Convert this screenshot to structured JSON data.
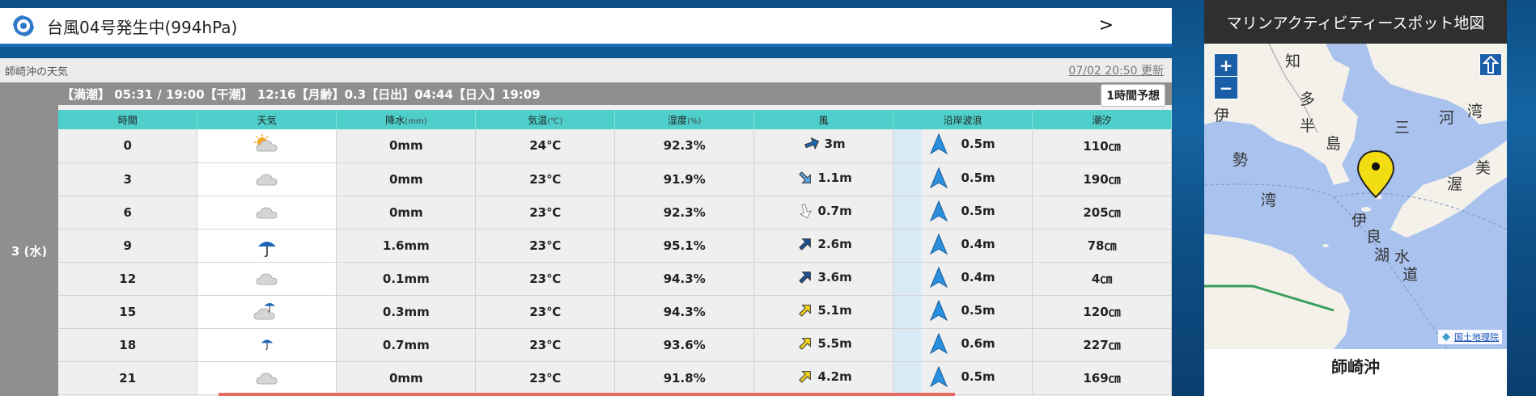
{
  "banner": {
    "text": "台風04号発生中(994hPa)",
    "arrow": ">"
  },
  "panel": {
    "location": "師崎沖の天気",
    "updated": "07/02 20:50 更新",
    "tide_info": "【満潮】 05:31 / 19:00【干潮】 12:16【月齢】0.3【日出】04:44【日入】19:09",
    "hourly_button": "1時間予想",
    "day_label": "3 (水)"
  },
  "table": {
    "headers": [
      {
        "label": "時間",
        "unit": ""
      },
      {
        "label": "天気",
        "unit": ""
      },
      {
        "label": "降水",
        "unit": "(mm)"
      },
      {
        "label": "気温",
        "unit": "(℃)"
      },
      {
        "label": "湿度",
        "unit": "(%)"
      },
      {
        "label": "風",
        "unit": ""
      },
      {
        "label": "沿岸波浪",
        "unit": ""
      },
      {
        "label": "潮汐",
        "unit": ""
      }
    ],
    "rows": [
      {
        "time": "0",
        "weather": "partly-cloudy-icon",
        "precip": "0mm",
        "temp": "24℃",
        "humidity": "92.3%",
        "wind_dir": "northeast-arrow-icon",
        "wind_color": "#1d6bb5",
        "wind": "3m",
        "wave": "0.5m",
        "tide": "110㎝"
      },
      {
        "time": "3",
        "weather": "cloud-icon",
        "precip": "0mm",
        "temp": "23℃",
        "humidity": "91.9%",
        "wind_dir": "east-arrow-icon",
        "wind_color": "#5aa3de",
        "wind": "1.1m",
        "wave": "0.5m",
        "tide": "190㎝"
      },
      {
        "time": "6",
        "weather": "cloud-icon",
        "precip": "0mm",
        "temp": "23℃",
        "humidity": "92.3%",
        "wind_dir": "southeast-arrow-icon",
        "wind_color": "#ffffff",
        "wind": "0.7m",
        "wave": "0.5m",
        "tide": "205㎝"
      },
      {
        "time": "9",
        "weather": "umbrella-icon",
        "precip": "1.6mm",
        "temp": "23℃",
        "humidity": "95.1%",
        "wind_dir": "north-arrow-icon",
        "wind_color": "#1d4f96",
        "wind": "2.6m",
        "wave": "0.4m",
        "tide": "78㎝"
      },
      {
        "time": "12",
        "weather": "cloud-icon",
        "precip": "0.1mm",
        "temp": "23℃",
        "humidity": "94.3%",
        "wind_dir": "north-arrow-icon",
        "wind_color": "#1d4f96",
        "wind": "3.6m",
        "wave": "0.4m",
        "tide": "4㎝"
      },
      {
        "time": "15",
        "weather": "cloud-rain-icon",
        "precip": "0.3mm",
        "temp": "23℃",
        "humidity": "94.3%",
        "wind_dir": "north-arrow-icon",
        "wind_color": "#f2d21a",
        "wind": "5.1m",
        "wave": "0.5m",
        "tide": "120㎝"
      },
      {
        "time": "18",
        "weather": "umbrella-small-icon",
        "precip": "0.7mm",
        "temp": "23℃",
        "humidity": "93.6%",
        "wind_dir": "north-arrow-icon",
        "wind_color": "#f2d21a",
        "wind": "5.5m",
        "wave": "0.6m",
        "tide": "227㎝"
      },
      {
        "time": "21",
        "weather": "cloud-icon",
        "precip": "0mm",
        "temp": "23℃",
        "humidity": "91.8%",
        "wind_dir": "north-arrow-icon",
        "wind_color": "#f2d21a",
        "wind": "4.2m",
        "wave": "0.5m",
        "tide": "169㎝"
      }
    ]
  },
  "map": {
    "title": "マリンアクティビティースポット地図",
    "zoom_in": "+",
    "zoom_out": "−",
    "attribution": "国土地理院",
    "spot_name": "師崎沖",
    "labels": {
      "chita": "知",
      "ta": "多",
      "han": "半",
      "shima": "島",
      "mi": "三",
      "ka": "河",
      "wan": "湾",
      "ise": "伊",
      "sei": "勢",
      "ise_wan": "湾",
      "atsu": "渥",
      "bi": "美",
      "iragomizu": "伊",
      "ra": "良",
      "ko": "湖",
      "sui": "水",
      "dou": "道"
    },
    "colors": {
      "sea": "#a9c2ee",
      "land": "#f4f1ea",
      "marker": "#f2dc12"
    }
  }
}
